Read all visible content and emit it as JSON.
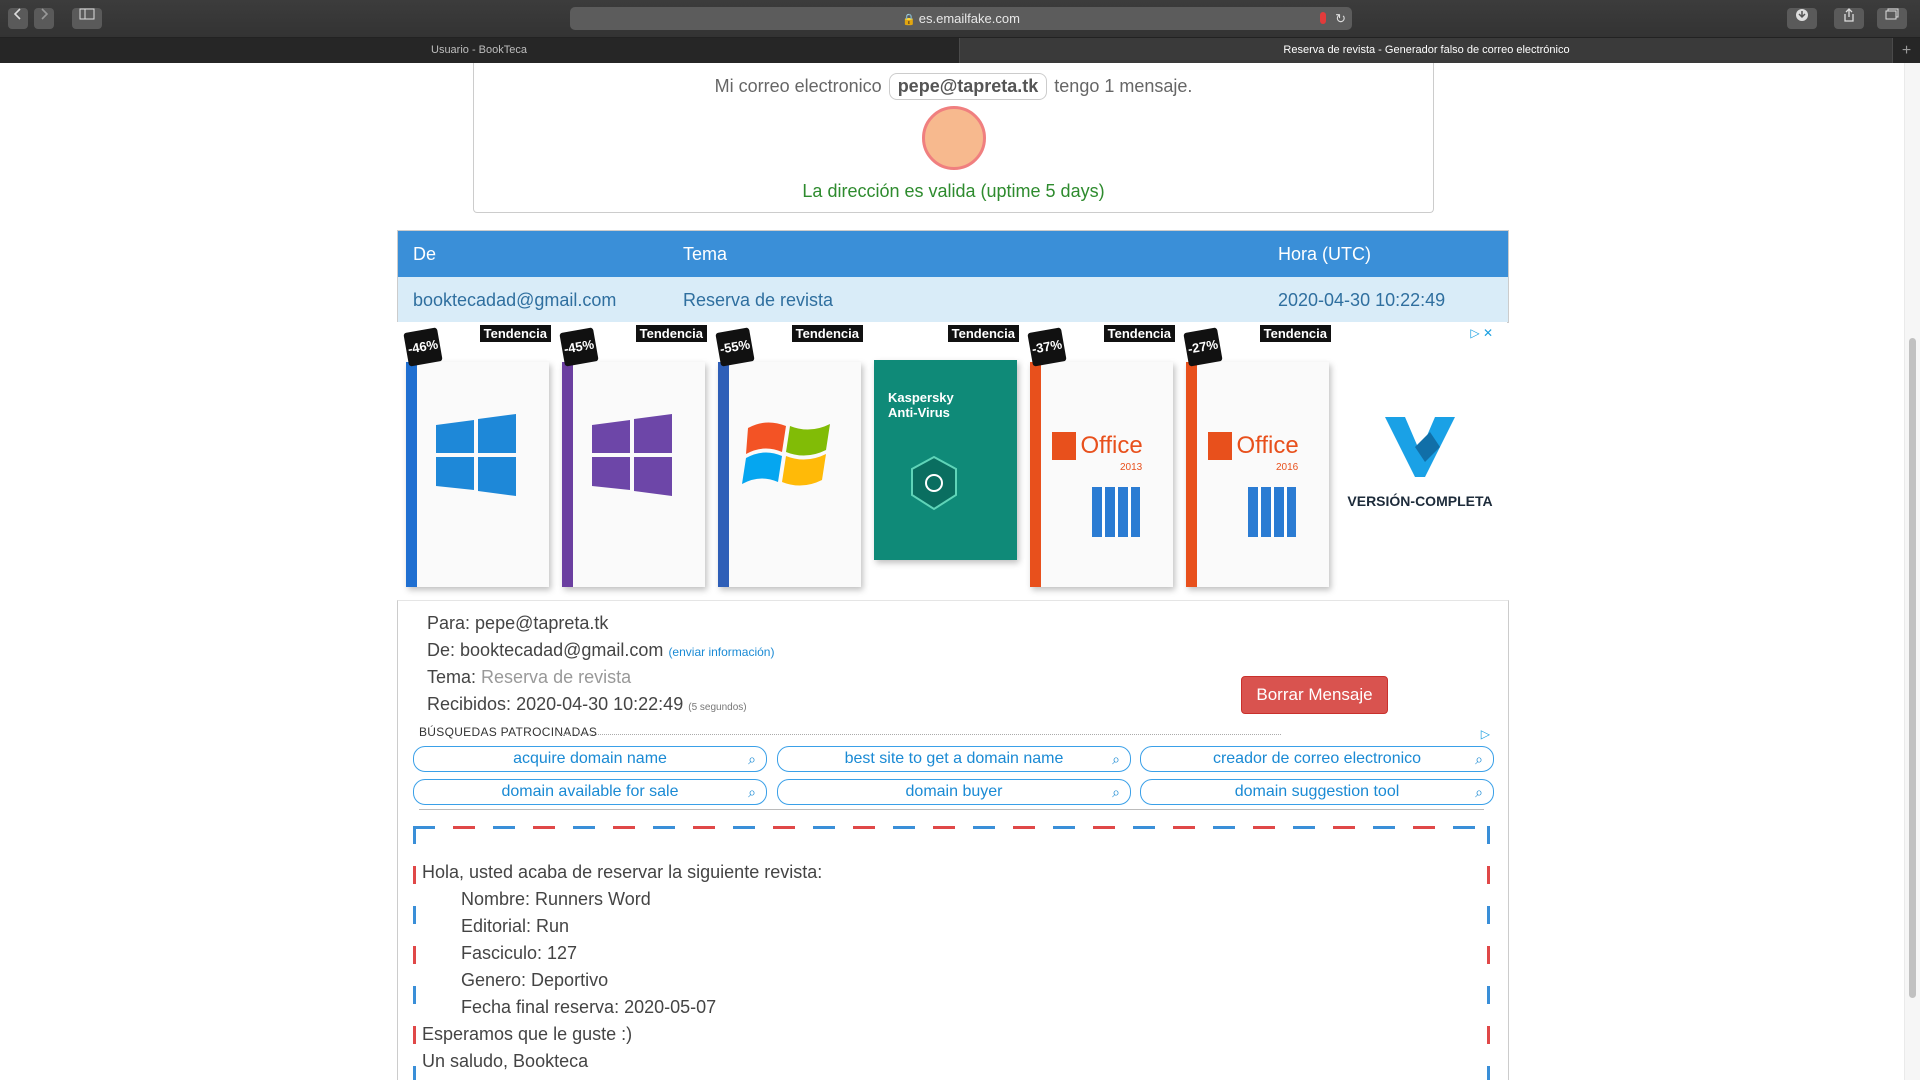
{
  "browser": {
    "url": "es.emailfake.com",
    "tabs": [
      {
        "label": "Usuario - BookTeca",
        "active": false
      },
      {
        "label": "Reserva de revista - Generador falso de correo electrónico",
        "active": true
      }
    ]
  },
  "mailbox": {
    "prefix": "Mi correo electronico",
    "address": "pepe@tapreta.tk",
    "suffix": "tengo 1 mensaje.",
    "status": "La dirección es valida (uptime 5 days)"
  },
  "table": {
    "headers": {
      "from": "De",
      "subject": "Tema",
      "time": "Hora (UTC)"
    },
    "row": {
      "from": "booktecadad@gmail.com",
      "subject": "Reserva de revista",
      "time": "2020-04-30 10:22:49"
    }
  },
  "ads": {
    "products": [
      {
        "badge": "Tendencia",
        "discount": "-46%",
        "spine_color": "#1f6fd1",
        "logo": "windows10-icon"
      },
      {
        "badge": "Tendencia",
        "discount": "-45%",
        "spine_color": "#6b3fa0",
        "logo": "windows10-icon"
      },
      {
        "badge": "Tendencia",
        "discount": "-55%",
        "spine_color": "#2f5fb8",
        "logo": "windows7-icon"
      },
      {
        "badge": "Tendencia",
        "discount": "",
        "spine_color": "#0f8a78",
        "logo": "kaspersky-icon",
        "box_title": "Kaspersky Anti-Virus"
      },
      {
        "badge": "Tendencia",
        "discount": "-37%",
        "spine_color": "#e8501c",
        "logo": "office-icon",
        "box_title": "Office",
        "box_sub": "2013"
      },
      {
        "badge": "Tendencia",
        "discount": "-27%",
        "spine_color": "#e8501c",
        "logo": "office-icon",
        "box_title": "Office",
        "box_sub": "2016"
      }
    ],
    "brand": "VERSIÓN-COMPLETA"
  },
  "message": {
    "to_label": "Para:",
    "to": "pepe@tapreta.tk",
    "from_label": "De:",
    "from": "booktecadad@gmail.com",
    "send_info": "(enviar información)",
    "subject_label": "Tema:",
    "subject": "Reserva de revista",
    "received_label": "Recibidos:",
    "received": "2020-04-30 10:22:49",
    "received_ago": "(5 segundos)",
    "delete_label": "Borrar Mensaje"
  },
  "sponsored": {
    "title": "BÚSQUEDAS PATROCINADAS",
    "links": [
      "acquire domain name",
      "best site to get a domain name",
      "creador de correo electronico",
      "domain available for sale",
      "domain buyer",
      "domain suggestion tool"
    ]
  },
  "body": {
    "lines": [
      "Hola, usted acaba de reservar la siguiente revista:",
      "Nombre: Runners Word",
      "Editorial: Run",
      "Fasciculo: 127",
      "Genero: Deportivo",
      "Fecha final reserva: 2020-05-07",
      "Esperamos que le guste :)",
      "Un saludo, Bookteca"
    ]
  },
  "colors": {
    "header": "#3a8fd8",
    "row": "#d9ecf8",
    "danger": "#d9534f",
    "valid": "#2e8b2e"
  }
}
